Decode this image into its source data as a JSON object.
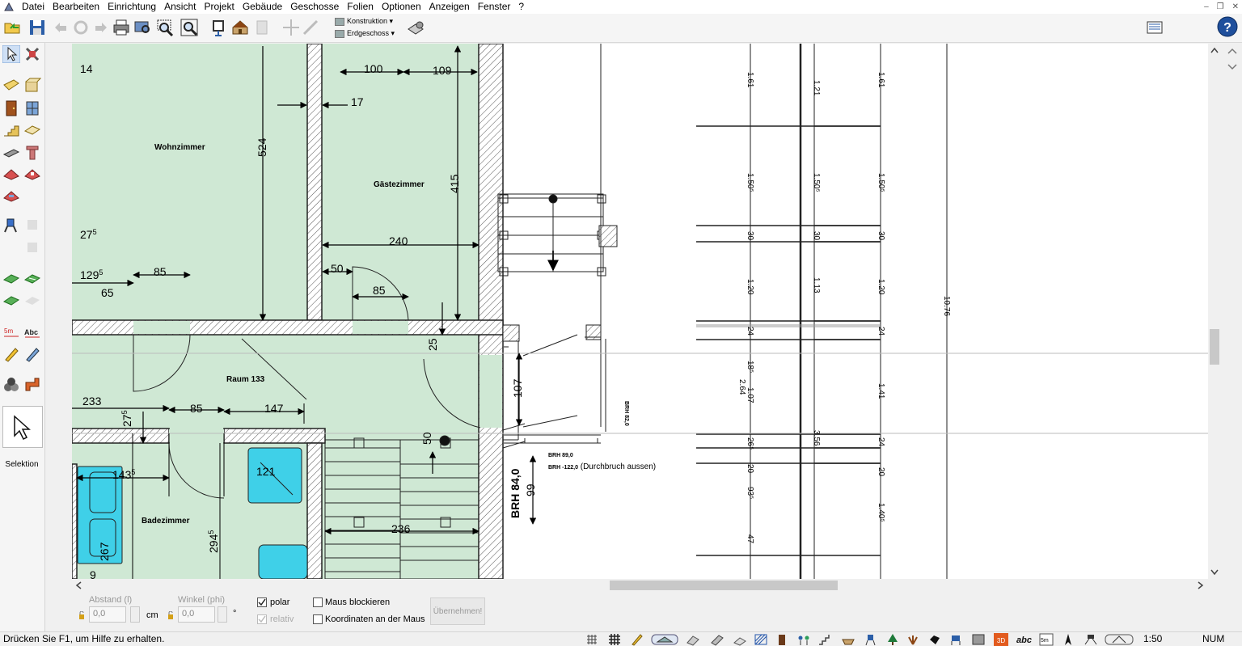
{
  "menu": [
    "Datei",
    "Bearbeiten",
    "Einrichtung",
    "Ansicht",
    "Projekt",
    "Gebäude",
    "Geschosse",
    "Folien",
    "Optionen",
    "Anzeigen",
    "Fenster",
    "?"
  ],
  "toolbar": {
    "layer_combo": "Konstruktion ▾",
    "floor_combo": "Erdgeschoss ▾"
  },
  "toolbox": {
    "selection_label": "Selektion"
  },
  "plan": {
    "rooms": {
      "wohnzimmer": "Wohnzimmer",
      "gaestezimmer": "Gästezimmer",
      "raum133": "Raum 133",
      "badezimmer": "Badezimmer"
    },
    "dims": {
      "d14": "14",
      "d100": "100",
      "d109": "109",
      "d17": "17",
      "d524": "524",
      "d415": "415",
      "d240": "240",
      "d275a": "27",
      "d275a_sup": "5",
      "d1295": "129",
      "d1295_sup": "5",
      "d85a": "85",
      "d65": "65",
      "d50a": "50",
      "d85b": "85",
      "d25": "25",
      "d233": "233",
      "d85c": "85",
      "d147": "147",
      "d107": "107",
      "d275b": "27",
      "d275b_sup": "5",
      "d1435": "143",
      "d1435_sup": "5",
      "d121": "121",
      "d50b": "50",
      "d2945": "294",
      "d2945_sup": "5",
      "d267": "267",
      "d236": "236",
      "d99": "99",
      "d9": "9"
    },
    "brh": {
      "brh84": "BRH 84,0",
      "brh82": "BRH 82,0",
      "brh89": "BRH 89,0",
      "brh_minus": "BRH -122,0",
      "durchbruch": " (Durchbruch aussen)"
    },
    "elevation": {
      "c1": [
        "1.61",
        "1.50⁵",
        "30",
        "1.20",
        "24",
        "18⁵",
        "2.64",
        "1.07",
        "26⁵",
        "20",
        "93⁵",
        "47"
      ],
      "c2": [
        "1.21",
        "1.50⁵",
        "30",
        "1.13",
        "3.56"
      ],
      "c3": [
        "1.61",
        "1.50⁵",
        "30",
        "1.20",
        "24",
        "1.41",
        "24",
        "20",
        "1.40⁵"
      ],
      "total": "10.76"
    }
  },
  "input": {
    "distance_label": "Abstand (l)",
    "distance_value": "0,0",
    "unit_cm": "cm",
    "angle_label": "Winkel (phi)",
    "angle_value": "0,0",
    "unit_deg": "°",
    "polar": "polar",
    "relativ": "relativ",
    "maus_blockieren": "Maus blockieren",
    "koordinaten": "Koordinaten an der Maus",
    "apply": "Übernehmen!"
  },
  "status": {
    "help": "Drücken Sie F1, um Hilfe zu erhalten.",
    "scale": "1:50",
    "num": "NUM"
  },
  "colors": {
    "room_fill": "#cfe8d4",
    "hatch": "#555555",
    "bath_blue": "#3fd0e8",
    "canvas": "#ffffff"
  }
}
